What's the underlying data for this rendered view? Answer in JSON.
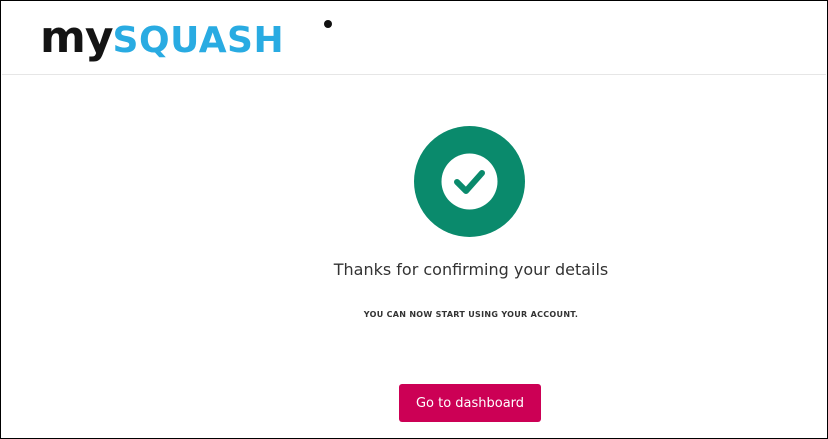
{
  "brand": {
    "logo_my": "my",
    "logo_squash": "SQUASH",
    "primary_color": "#29abe2",
    "dark_color": "#141414"
  },
  "confirmation": {
    "icon": "check-circle-icon",
    "icon_color": "#0a8a6c",
    "title": "Thanks for confirming your details",
    "subtitle": "YOU CAN NOW START USING YOUR ACCOUNT."
  },
  "actions": {
    "dashboard_label": "Go to dashboard",
    "dashboard_color": "#cc0055"
  }
}
